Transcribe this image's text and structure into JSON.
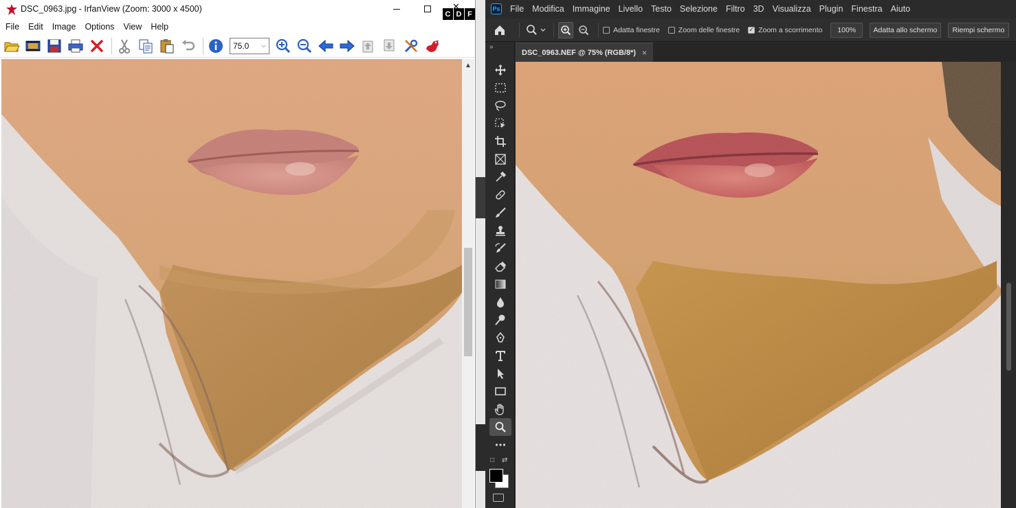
{
  "irfanview": {
    "title": "DSC_0963.jpg - IrfanView (Zoom: 3000 x 4500)",
    "side_tabs": [
      "C",
      "D",
      "F"
    ],
    "menu": [
      "File",
      "Edit",
      "Image",
      "Options",
      "View",
      "Help"
    ],
    "toolbar_icons": [
      "open-folder-icon",
      "slideshow-icon",
      "save-icon",
      "print-icon",
      "delete-icon",
      "cut-icon",
      "copy-icon",
      "paste-icon",
      "undo-icon",
      "info-icon",
      "zoom-in-icon",
      "zoom-out-icon",
      "previous-icon",
      "next-icon",
      "page-up-icon",
      "page-down-icon",
      "settings-icon",
      "irfan-logo-icon"
    ],
    "zoom_value": "75.0"
  },
  "photoshop": {
    "logo": "Ps",
    "menu": [
      "File",
      "Modifica",
      "Immagine",
      "Livello",
      "Testo",
      "Selezione",
      "Filtro",
      "3D",
      "Visualizza",
      "Plugin",
      "Finestra",
      "Aiuto"
    ],
    "options": {
      "fit_windows": "Adatta finestre",
      "zoom_all_windows": "Zoom delle finestre",
      "scrubby_zoom": "Zoom a scorrimento",
      "scrubby_checked": true,
      "zoom_100": "100%",
      "fit_screen": "Adatta allo schermo",
      "fill_screen": "Riempi schermo"
    },
    "document_tab": "DSC_0963.NEF @ 75% (RGB/8*)",
    "document_close": "×",
    "tools": [
      "move-icon",
      "marquee-icon",
      "lasso-icon",
      "object-select-icon",
      "crop-icon",
      "frame-icon",
      "eyedropper-icon",
      "healing-icon",
      "brush-icon",
      "stamp-icon",
      "history-brush-icon",
      "eraser-icon",
      "gradient-icon",
      "blur-icon",
      "dodge-icon",
      "pen-icon",
      "type-icon",
      "path-select-icon",
      "rectangle-icon",
      "hand-icon",
      "zoom-icon",
      "more-icon"
    ],
    "active_tool": "zoom-icon",
    "colors": {
      "foreground": "#000000",
      "background": "#ffffff"
    }
  }
}
